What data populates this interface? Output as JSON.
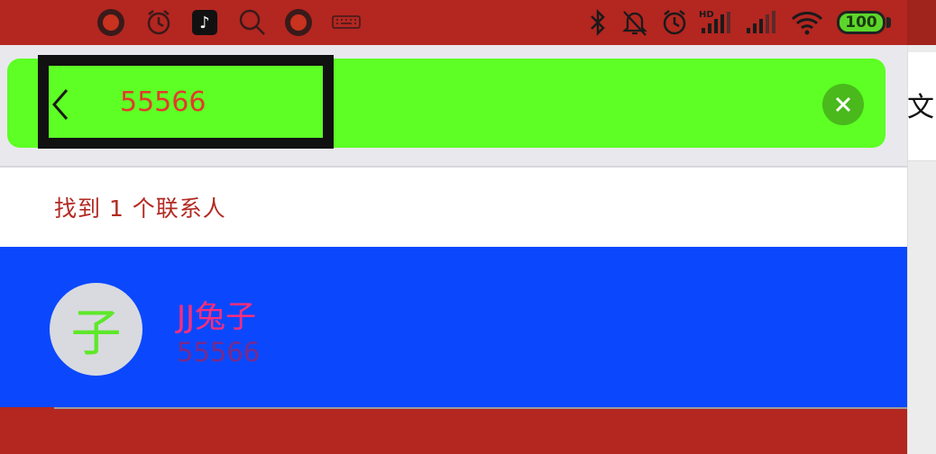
{
  "status_bar": {
    "left_icons": [
      "record-icon",
      "alarm-icon",
      "tiktok-icon",
      "search-icon",
      "record-icon",
      "keyboard-icon"
    ],
    "right_icons": [
      "bluetooth-icon",
      "mute-bell-icon",
      "alarm-icon",
      "hd-signal-icon",
      "signal-icon",
      "wifi-icon"
    ],
    "signal_label": "HD",
    "battery": "100"
  },
  "search": {
    "back_icon": "chevron-left-icon",
    "value": "55566",
    "clear_icon": "close-icon"
  },
  "results": {
    "count_text": "找到 1 个联系人"
  },
  "contacts": [
    {
      "avatar_char": "子",
      "name": "JJ兔子",
      "number": "55566"
    }
  ],
  "side_panel": {
    "partial_text": "文"
  },
  "colors": {
    "status_bg": "#b42620",
    "search_bar": "#5dff24",
    "search_text": "#e33a2a",
    "contact_row": "#0b48fd",
    "contact_name": "#ff2d7a",
    "avatar_text": "#5ee82a"
  }
}
